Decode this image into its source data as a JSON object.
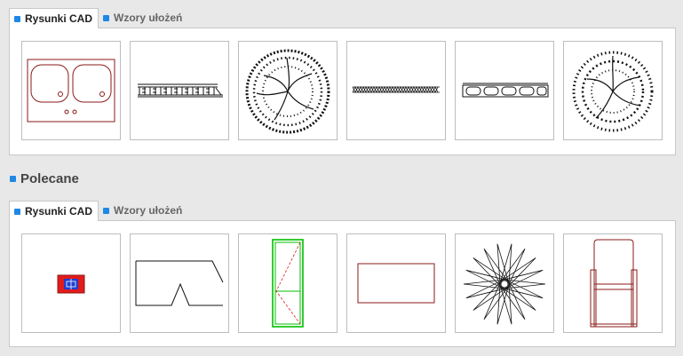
{
  "top_section": {
    "tabs": [
      {
        "label": "Rysunki CAD",
        "active": true
      },
      {
        "label": "Wzory ułożeń",
        "active": false
      }
    ],
    "thumbnails": [
      {
        "icon": "double-sink-drawing"
      },
      {
        "icon": "balustrade-elevation-drawing"
      },
      {
        "icon": "tree-top-view-drawing"
      },
      {
        "icon": "chain-pattern-drawing"
      },
      {
        "icon": "hollow-block-section-drawing"
      },
      {
        "icon": "tree-top-view-drawing"
      }
    ]
  },
  "recommended": {
    "title": "Polecane",
    "tabs": [
      {
        "label": "Rysunki CAD",
        "active": true
      },
      {
        "label": "Wzory ułożeń",
        "active": false
      }
    ],
    "thumbnails": [
      {
        "icon": "red-blue-element-drawing"
      },
      {
        "icon": "profile-line-drawing"
      },
      {
        "icon": "green-door-drawing"
      },
      {
        "icon": "rectangle-drawing"
      },
      {
        "icon": "star-flower-drawing"
      },
      {
        "icon": "armchair-drawing"
      }
    ]
  },
  "colors": {
    "accent": "#1e88e5",
    "cad_red": "#8b1a1a",
    "cad_green": "#00c000"
  }
}
